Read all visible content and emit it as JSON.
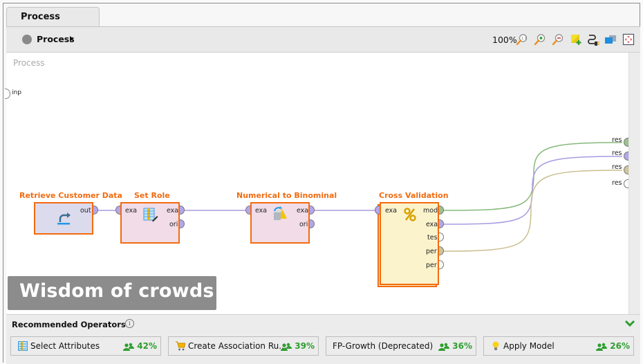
{
  "tab": {
    "label": "Process"
  },
  "toolbar": {
    "breadcrumb_label": "Process",
    "zoom_level": "100%",
    "icons": [
      "zoom-reset-icon",
      "zoom-in-icon",
      "zoom-out-icon",
      "add-note-icon",
      "auto-wire-icon",
      "layers-icon",
      "fit-view-icon"
    ]
  },
  "canvas": {
    "title": "Process",
    "input_port": "inp",
    "result_ports": [
      "res",
      "res",
      "res",
      "res"
    ],
    "operators": [
      {
        "name": "Retrieve Customer Data",
        "icon": "retrieve-icon",
        "in_ports": [],
        "out_ports": [
          "out"
        ]
      },
      {
        "name": "Set Role",
        "icon": "set-role-icon",
        "in_ports": [
          "exa"
        ],
        "out_ports": [
          "exa",
          "ori"
        ]
      },
      {
        "name": "Numerical to Binominal",
        "icon": "convert-icon",
        "in_ports": [
          "exa"
        ],
        "out_ports": [
          "exa",
          "ori"
        ]
      },
      {
        "name": "Cross Validation",
        "icon": "percent-icon",
        "in_ports": [
          "exa"
        ],
        "out_ports": [
          "mod",
          "exa",
          "tes",
          "per",
          "per"
        ]
      }
    ],
    "colors": {
      "operator_border": "#f26b10",
      "example_port": "#b4a7e8",
      "model_port": "#9cc18f",
      "performance_port": "#cfc59b",
      "wire_example": "#a89be0",
      "wire_model": "#86b87a",
      "wire_performance": "#c9bd8e"
    }
  },
  "banner": {
    "text": "Wisdom of crowds"
  },
  "recommended": {
    "title": "Recommended Operators",
    "items": [
      {
        "label": "Select Attributes",
        "percent": "42%",
        "icon": "table-icon"
      },
      {
        "label": "Create Association Ru...",
        "percent": "39%",
        "icon": "cart-icon"
      },
      {
        "label": "FP-Growth (Deprecated)",
        "percent": "36%",
        "icon": ""
      },
      {
        "label": "Apply Model",
        "percent": "26%",
        "icon": "lightbulb-icon"
      }
    ]
  }
}
